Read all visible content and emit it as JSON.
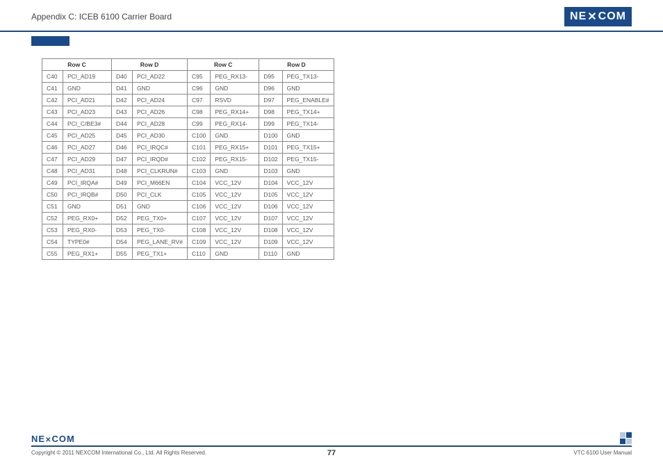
{
  "header": {
    "title": "Appendix C: ICEB 6100 Carrier Board",
    "logo_text": "NEXCOM"
  },
  "table": {
    "headers": [
      "Row C",
      "Row D",
      "Row C",
      "Row D"
    ],
    "rows": [
      [
        "C40",
        "PCI_AD19",
        "D40",
        "PCI_AD22",
        "C95",
        "PEG_RX13-",
        "D95",
        "PEG_TX13-"
      ],
      [
        "C41",
        "GND",
        "D41",
        "GND",
        "C96",
        "GND",
        "D96",
        "GND"
      ],
      [
        "C42",
        "PCI_AD21",
        "D42",
        "PCI_AD24",
        "C97",
        "RSVD",
        "D97",
        "PEG_ENABLE#"
      ],
      [
        "C43",
        "PCI_AD23",
        "D43",
        "PCI_AD26",
        "C98",
        "PEG_RX14+",
        "D98",
        "PEG_TX14+"
      ],
      [
        "C44",
        "PCI_C/BE3#",
        "D44",
        "PCI_AD28",
        "C99",
        "PEG_RX14-",
        "D99",
        "PEG_TX14-"
      ],
      [
        "C45",
        "PCI_AD25",
        "D45",
        "PCI_AD30",
        "C100",
        "GND",
        "D100",
        "GND"
      ],
      [
        "C46",
        "PCI_AD27",
        "D46",
        "PCI_IRQC#",
        "C101",
        "PEG_RX15+",
        "D101",
        "PEG_TX15+"
      ],
      [
        "C47",
        "PCI_AD29",
        "D47",
        "PCI_IRQD#",
        "C102",
        "PEG_RX15-",
        "D102",
        "PEG_TX15-"
      ],
      [
        "C48",
        "PCI_AD31",
        "D48",
        "PCI_CLKRUN#",
        "C103",
        "GND",
        "D103",
        "GND"
      ],
      [
        "C49",
        "PCI_IRQA#",
        "D49",
        "PCI_M66EN",
        "C104",
        "VCC_12V",
        "D104",
        "VCC_12V"
      ],
      [
        "C50",
        "PCI_IRQB#",
        "D50",
        "PCI_CLK",
        "C105",
        "VCC_12V",
        "D105",
        "VCC_12V"
      ],
      [
        "C51",
        "GND",
        "D51",
        "GND",
        "C106",
        "VCC_12V",
        "D106",
        "VCC_12V"
      ],
      [
        "C52",
        "PEG_RX0+",
        "D52",
        "PEG_TX0+",
        "C107",
        "VCC_12V",
        "D107",
        "VCC_12V"
      ],
      [
        "C53",
        "PEG_RX0-",
        "D53",
        "PEG_TX0-",
        "C108",
        "VCC_12V",
        "D108",
        "VCC_12V"
      ],
      [
        "C54",
        "TYPE0#",
        "D54",
        "PEG_LANE_RV#",
        "C109",
        "VCC_12V",
        "D109",
        "VCC_12V"
      ],
      [
        "C55",
        "PEG_RX1+",
        "D55",
        "PEG_TX1+",
        "C110",
        "GND",
        "D110",
        "GND"
      ]
    ]
  },
  "footer": {
    "logo_text": "NEXCOM",
    "copyright": "Copyright © 2011 NEXCOM International Co., Ltd. All Rights Reserved.",
    "page": "77",
    "manual": "VTC 6100 User Manual"
  }
}
